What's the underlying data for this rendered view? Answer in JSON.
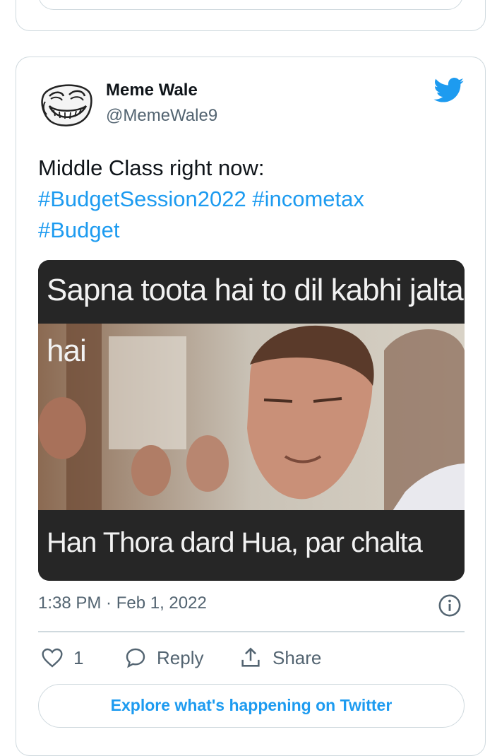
{
  "tweet": {
    "author_name": "Meme Wale",
    "author_handle": "@MemeWale9",
    "text_line1": "Middle Class right now:",
    "hashtags": [
      "#BudgetSession2022",
      "#incometax",
      "#Budget"
    ],
    "image": {
      "top_caption": "Sapna toota hai to dil kabhi jalta hai",
      "bottom_caption": "Han Thora dard Hua, par chalta hai"
    },
    "timestamp": "1:38 PM · Feb 1, 2022",
    "likes_count": "1",
    "reply_label": "Reply",
    "share_label": "Share",
    "explore_label": "Explore what's happening on Twitter"
  },
  "icons": {
    "brand": "twitter-bird-icon",
    "info": "info-icon",
    "like": "heart-icon",
    "reply": "speech-bubble-icon",
    "share": "share-upload-icon"
  },
  "colors": {
    "accent": "#1d9bf0",
    "text": "#0f1419",
    "muted": "#536471",
    "border": "#cfd9de"
  }
}
